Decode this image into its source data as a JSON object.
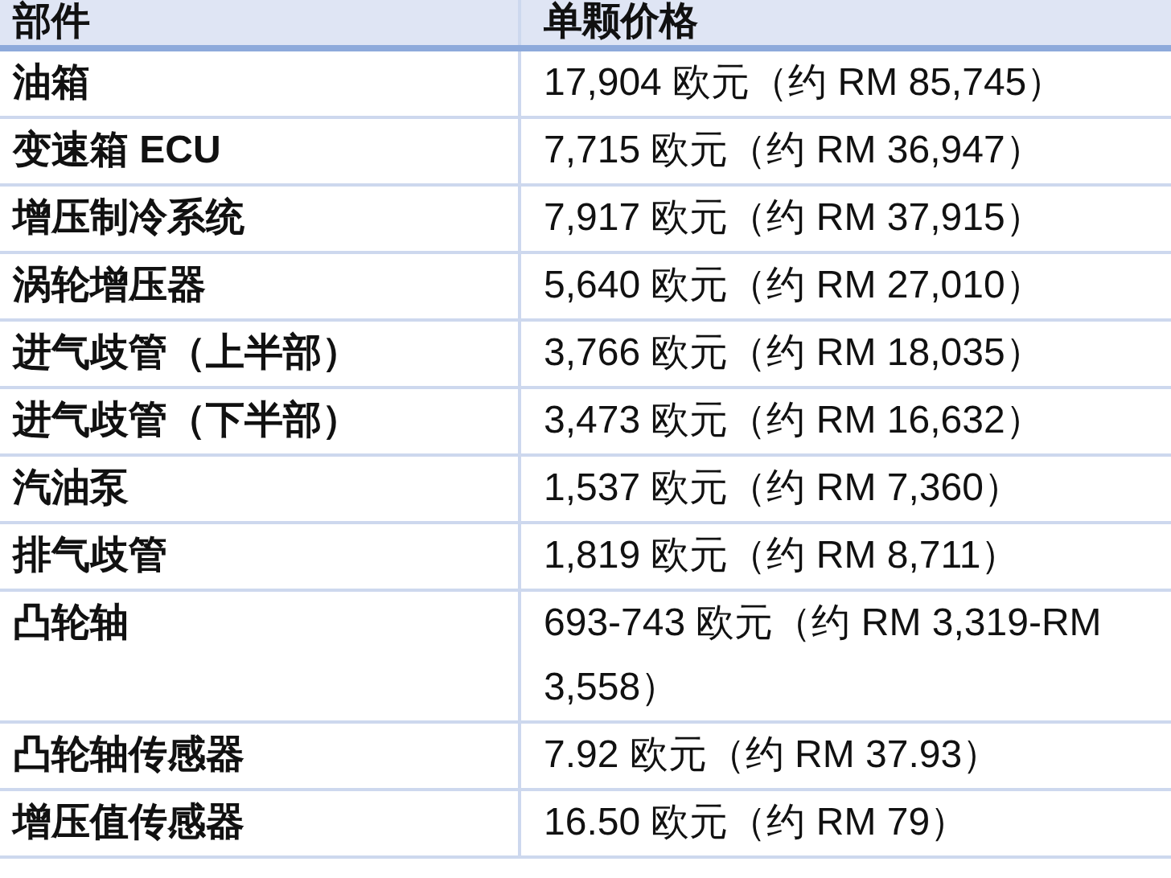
{
  "table": {
    "columns": [
      "部件",
      "单颗价格"
    ],
    "rows": [
      [
        "油箱",
        "17,904 欧元（约 RM 85,745）"
      ],
      [
        "变速箱 ECU",
        "7,715 欧元（约 RM 36,947）"
      ],
      [
        "增压制冷系统",
        "7,917 欧元（约 RM 37,915）"
      ],
      [
        "涡轮增压器",
        "5,640 欧元（约 RM 27,010）"
      ],
      [
        "进气歧管（上半部）",
        "3,766 欧元（约 RM 18,035）"
      ],
      [
        "进气歧管（下半部）",
        "3,473 欧元（约 RM 16,632）"
      ],
      [
        "汽油泵",
        "1,537 欧元（约 RM 7,360）"
      ],
      [
        "排气歧管",
        "1,819 欧元（约 RM 8,711）"
      ],
      [
        "凸轮轴",
        "693-743 欧元（约 RM 3,319-RM 3,558）"
      ],
      [
        "凸轮轴传感器",
        "7.92 欧元（约 RM 37.93）"
      ],
      [
        "增压值传感器",
        "16.50 欧元（约 RM 79）"
      ]
    ]
  }
}
